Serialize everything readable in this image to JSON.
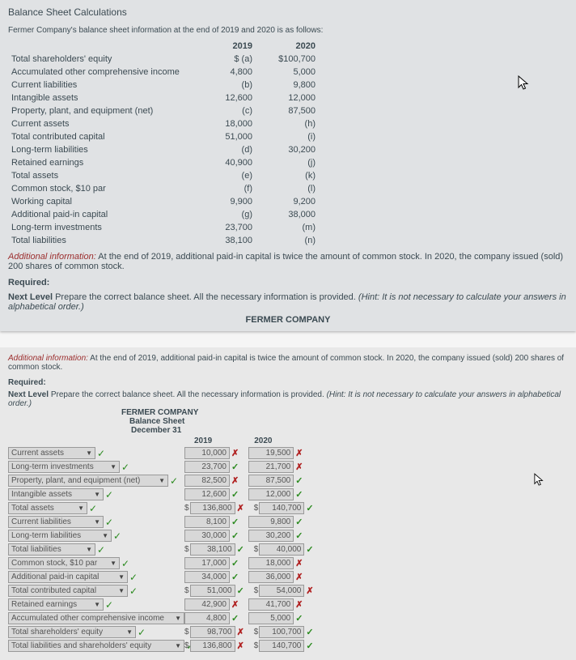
{
  "panel1": {
    "heading": "Balance Sheet Calculations",
    "intro": "Fermer Company's balance sheet information at the end of 2019 and 2020 is as follows:",
    "hdr2019": "2019",
    "hdr2020": "2020",
    "rows": [
      {
        "label": "Total shareholders' equity",
        "c19": "$ (a)",
        "c20": "$100,700"
      },
      {
        "label": "Accumulated other comprehensive income",
        "c19": "4,800",
        "c20": "5,000"
      },
      {
        "label": "Current liabilities",
        "c19": "(b)",
        "c20": "9,800"
      },
      {
        "label": "Intangible assets",
        "c19": "12,600",
        "c20": "12,000"
      },
      {
        "label": "Property, plant, and equipment (net)",
        "c19": "(c)",
        "c20": "87,500"
      },
      {
        "label": "Current assets",
        "c19": "18,000",
        "c20": "(h)"
      },
      {
        "label": "Total contributed capital",
        "c19": "51,000",
        "c20": "(i)"
      },
      {
        "label": "Long-term liabilities",
        "c19": "(d)",
        "c20": "30,200"
      },
      {
        "label": "Retained earnings",
        "c19": "40,900",
        "c20": "(j)"
      },
      {
        "label": "Total assets",
        "c19": "(e)",
        "c20": "(k)"
      },
      {
        "label": "Common stock, $10 par",
        "c19": "(f)",
        "c20": "(l)"
      },
      {
        "label": "Working capital",
        "c19": "9,900",
        "c20": "9,200"
      },
      {
        "label": "Additional paid-in capital",
        "c19": "(g)",
        "c20": "38,000"
      },
      {
        "label": "Long-term investments",
        "c19": "23,700",
        "c20": "(m)"
      },
      {
        "label": "Total liabilities",
        "c19": "38,100",
        "c20": "(n)"
      }
    ],
    "addl_lbl": "Additional information:",
    "addl_txt": " At the end of 2019, additional paid-in capital is twice the amount of common stock. In 2020, the company issued (sold) 200 shares of common stock.",
    "req": "Required:",
    "nextlvl_b": "Next Level ",
    "nextlvl_t": "Prepare the correct balance sheet. All the necessary information is provided. ",
    "hint": "(Hint: It is not necessary to calculate your answers in alphabetical order.)",
    "company": "FERMER COMPANY"
  },
  "panel2": {
    "addl_lbl": "Additional information:",
    "addl_txt": " At the end of 2019, additional paid-in capital is twice the amount of common stock. In 2020, the company issued (sold) 200 shares of common stock.",
    "req": "Required:",
    "nextlvl_b": "Next Level ",
    "nextlvl_t": "Prepare the correct balance sheet. All the necessary information is provided. ",
    "hint": "(Hint: It is not necessary to calculate your answers in alphabetical order.)",
    "company": "FERMER COMPANY",
    "subtitle1": "Balance Sheet",
    "subtitle2": "December 31",
    "hdr2019": "2019",
    "hdr2020": "2020",
    "rows": [
      {
        "dd": "Current assets",
        "d": false,
        "v19": "10,000",
        "m19": "x",
        "v20": "19,500",
        "m20": "x",
        "dd_w": 100
      },
      {
        "dd": "Long-term investments",
        "d": false,
        "v19": "23,700",
        "m19": "v",
        "v20": "21,700",
        "m20": "x",
        "dd_w": 130
      },
      {
        "dd": "Property, plant, and equipment (net)",
        "d": false,
        "v19": "82,500",
        "m19": "x",
        "v20": "87,500",
        "m20": "v",
        "dd_w": 190
      },
      {
        "dd": "Intangible assets",
        "d": false,
        "v19": "12,600",
        "m19": "v",
        "v20": "12,000",
        "m20": "v",
        "dd_w": 110
      },
      {
        "dd": "Total assets",
        "d": true,
        "v19": "136,800",
        "m19": "x",
        "v20": "140,700",
        "m20": "v",
        "dd_w": 90
      },
      {
        "dd": "Current liabilities",
        "d": false,
        "v19": "8,100",
        "m19": "v",
        "v20": "9,800",
        "m20": "v",
        "dd_w": 110
      },
      {
        "dd": "Long-term liabilities",
        "d": false,
        "v19": "30,000",
        "m19": "v",
        "v20": "30,200",
        "m20": "v",
        "dd_w": 120
      },
      {
        "dd": "Total liabilities",
        "d": true,
        "v19": "38,100",
        "m19": "v",
        "v20": "40,000",
        "m20": "v",
        "dd_w": 100
      },
      {
        "dd": "Common stock, $10 par",
        "d": false,
        "v19": "17,000",
        "m19": "v",
        "v20": "18,000",
        "m20": "x",
        "dd_w": 130
      },
      {
        "dd": "Additional paid-in capital",
        "d": false,
        "v19": "34,000",
        "m19": "v",
        "v20": "36,000",
        "m20": "x",
        "dd_w": 140
      },
      {
        "dd": "Total contributed capital",
        "d": true,
        "v19": "51,000",
        "m19": "v",
        "v20": "54,000",
        "m20": "x",
        "dd_w": 140
      },
      {
        "dd": "Retained earnings",
        "d": false,
        "v19": "42,900",
        "m19": "x",
        "v20": "41,700",
        "m20": "x",
        "dd_w": 110
      },
      {
        "dd": "Accumulated other comprehensive income",
        "d": false,
        "v19": "4,800",
        "m19": "v",
        "v20": "5,000",
        "m20": "v",
        "dd_w": 210
      },
      {
        "dd": "Total shareholders' equity",
        "d": true,
        "v19": "98,700",
        "m19": "x",
        "v20": "100,700",
        "m20": "v",
        "dd_w": 150
      },
      {
        "dd": "Total liabilities and shareholders' equity",
        "d": true,
        "v19": "136,800",
        "m19": "x",
        "v20": "140,700",
        "m20": "v",
        "dd_w": 210
      }
    ]
  }
}
